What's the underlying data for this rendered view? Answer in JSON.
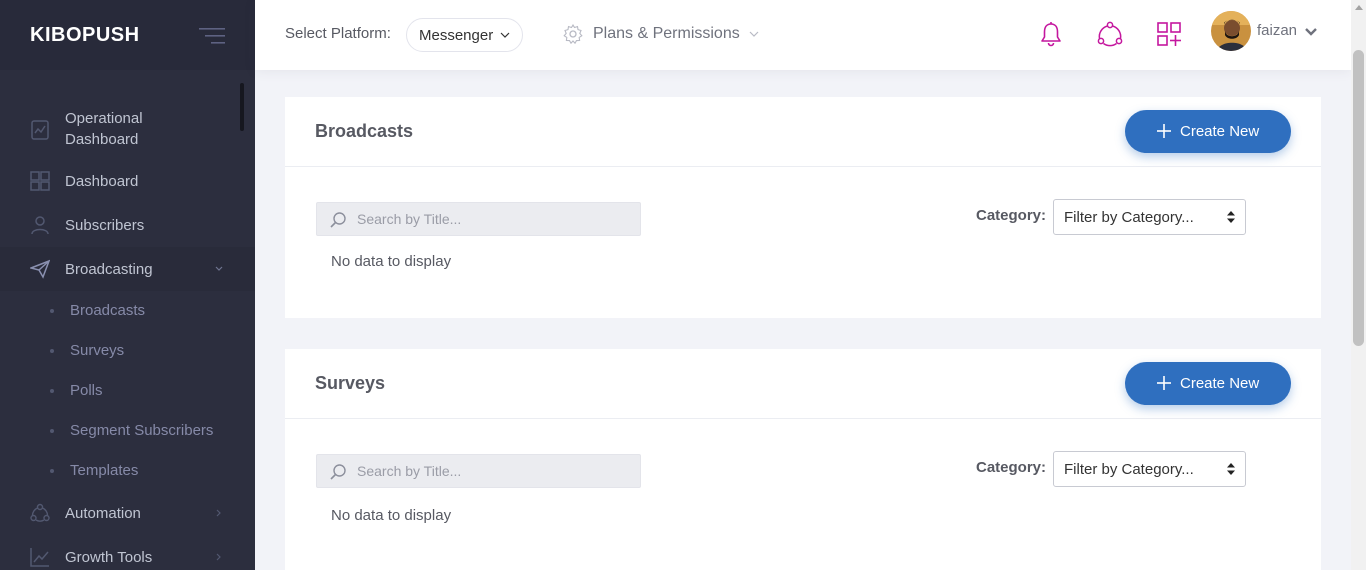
{
  "app": {
    "brand": "KIBOPUSH"
  },
  "sidebar": {
    "items": [
      {
        "label": "Operational Dashboard",
        "icon": "dashboard-report-icon"
      },
      {
        "label": "Dashboard",
        "icon": "grid-icon"
      },
      {
        "label": "Subscribers",
        "icon": "user-icon"
      },
      {
        "label": "Broadcasting",
        "icon": "paper-plane-icon",
        "expanded": true
      },
      {
        "label": "Automation",
        "icon": "automation-icon"
      },
      {
        "label": "Growth Tools",
        "icon": "chart-icon"
      }
    ],
    "broadcasting_sub": [
      "Broadcasts",
      "Surveys",
      "Polls",
      "Segment Subscribers",
      "Templates"
    ]
  },
  "header": {
    "platform_label": "Select Platform:",
    "platform_value": "Messenger",
    "plans_label": "Plans & Permissions",
    "user_name": "faizan"
  },
  "sections": [
    {
      "title": "Broadcasts",
      "create_label": "Create New",
      "search_placeholder": "Search by Title...",
      "category_label": "Category:",
      "category_value": "Filter by Category...",
      "empty_text": "No data to display"
    },
    {
      "title": "Surveys",
      "create_label": "Create New",
      "search_placeholder": "Search by Title...",
      "category_label": "Category:",
      "category_value": "Filter by Category...",
      "empty_text": "No data to display"
    }
  ],
  "colors": {
    "sidebar_bg": "#2c2e3e",
    "accent_blue": "#2f6fbf",
    "icon_magenta": "#c4179e"
  }
}
